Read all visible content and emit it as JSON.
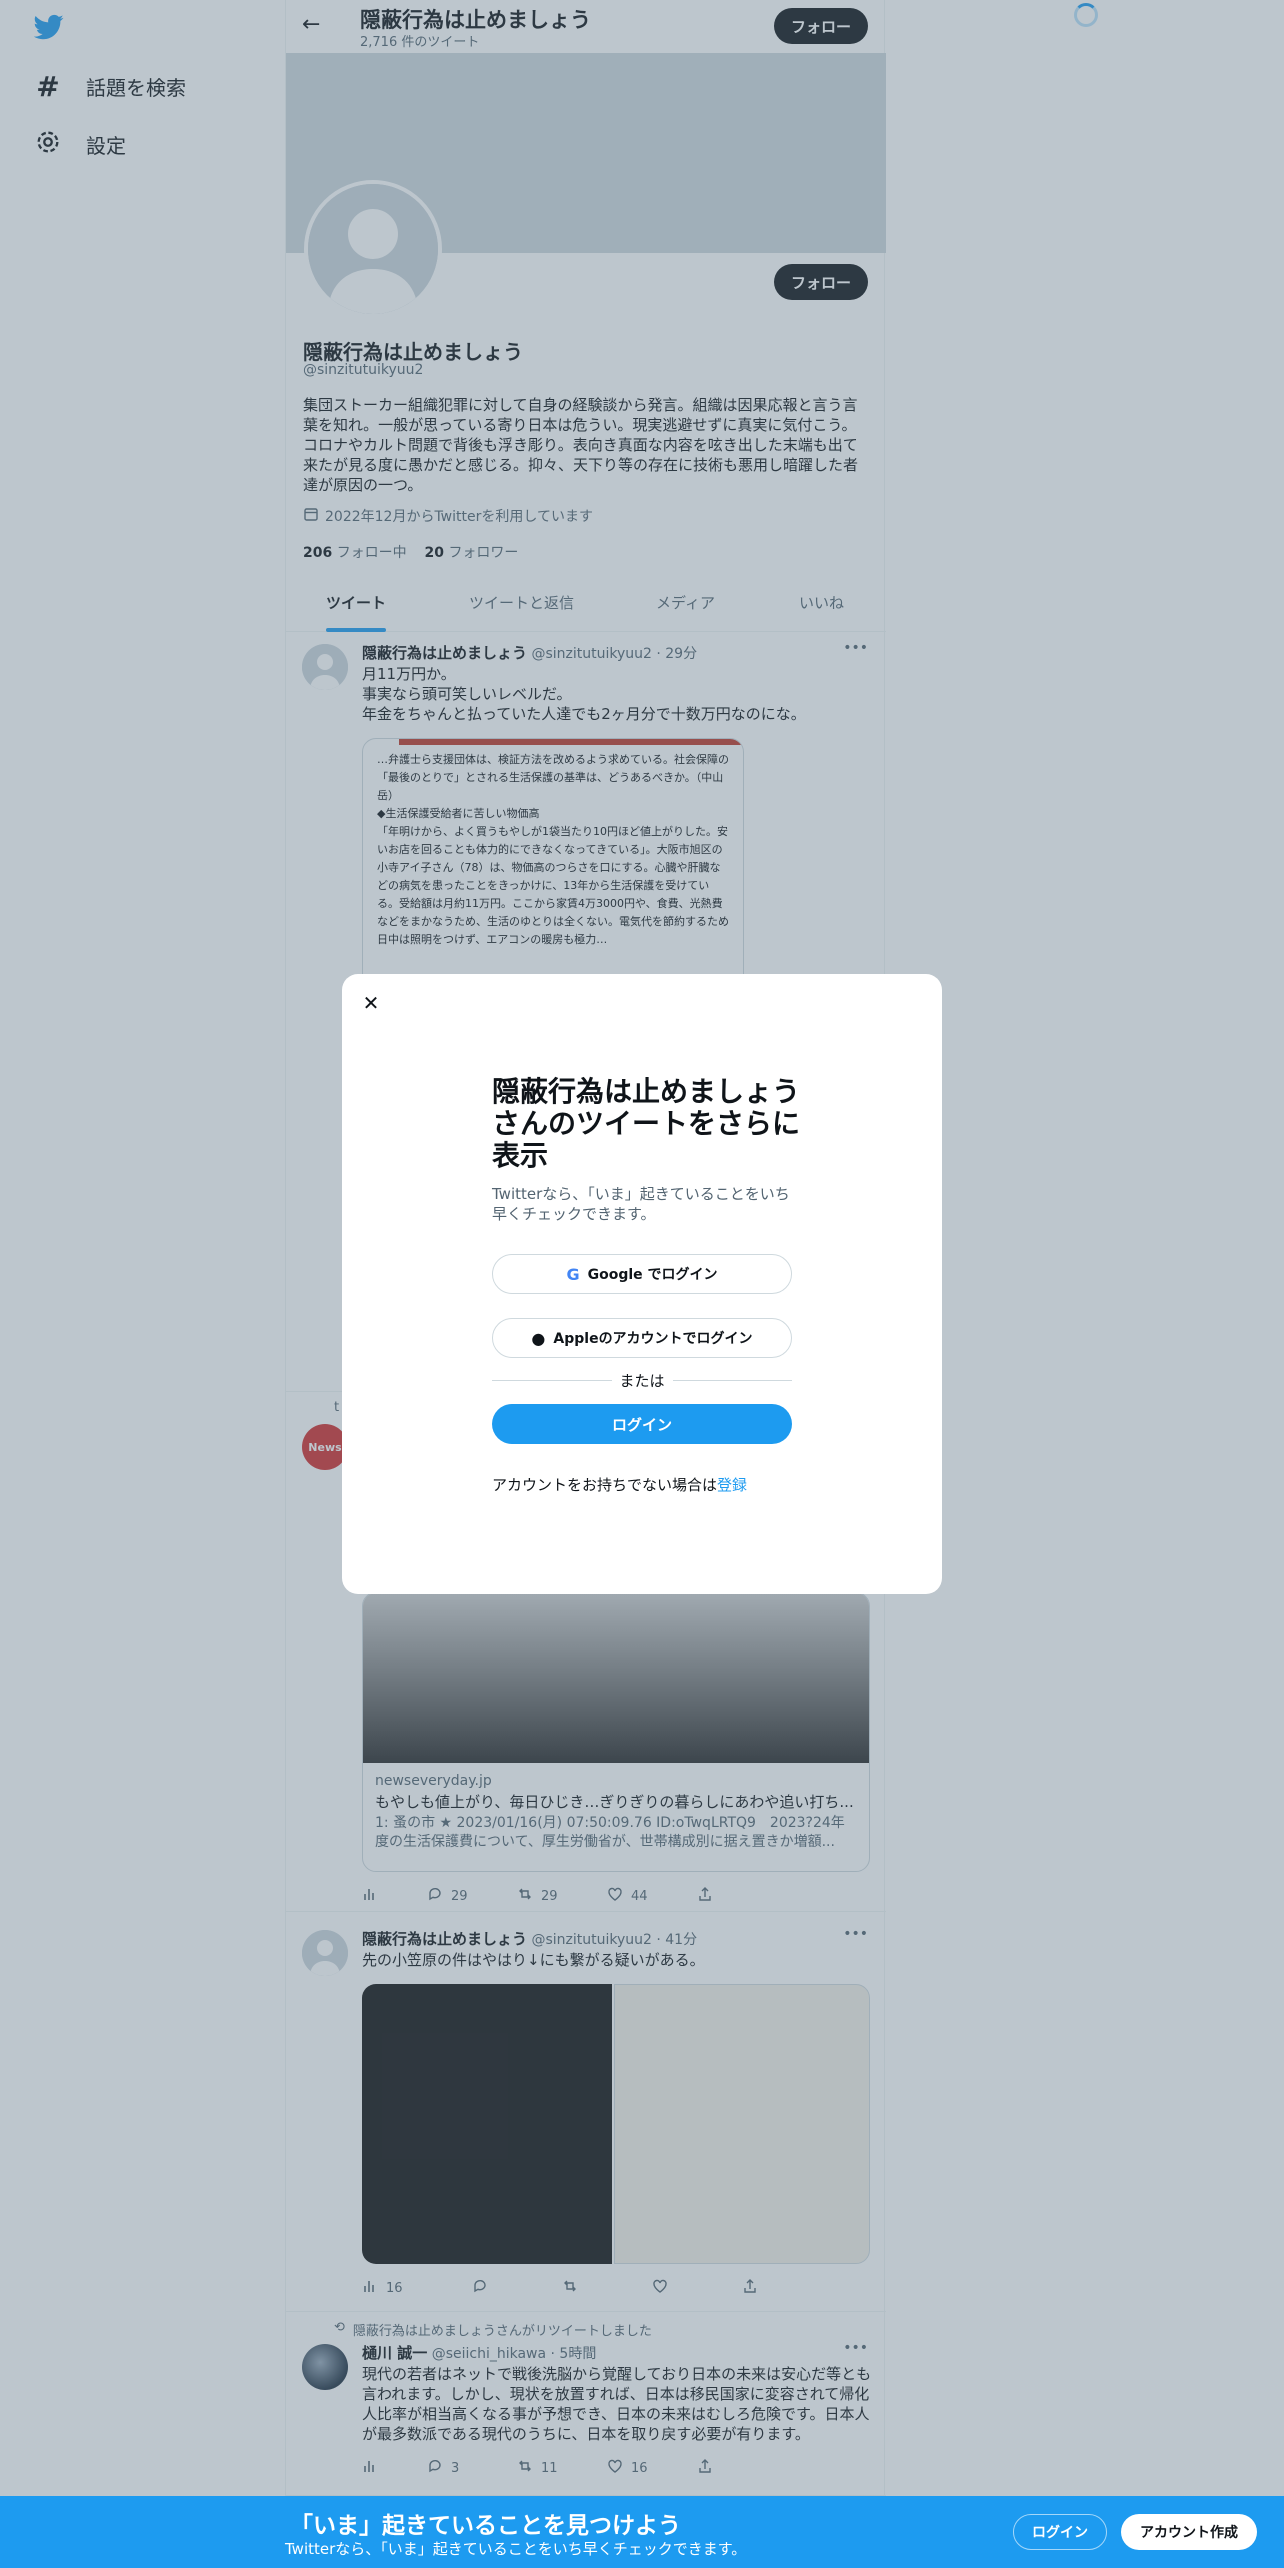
{
  "nav": {
    "explore_label": "話題を検索",
    "settings_label": "設定"
  },
  "header": {
    "name": "隠蔽行為は止めましょう",
    "tweet_count": "2,716 件のツイート",
    "follow_label": "フォロー"
  },
  "profile": {
    "name": "隠蔽行為は止めましょう",
    "handle": "@sinzitutuikyuu2",
    "bio": "集団ストーカー組織犯罪に対して自身の経験談から発言。組織は因果応報と言う言葉を知れ。一般が思っている寄り日本は危うい。現実逃避せずに真実に気付こう。コロナやカルト問題で背後も浮き彫り。表向き真面な内容を呟き出した末端も出て来たが見る度に愚かだと感じる。抑々、天下り等の存在に技術も悪用し暗躍した者達が原因の一つ。",
    "joined": "2022年12月からTwitterを利用しています",
    "following_count": "206",
    "following_label": "フォロー中",
    "followers_count": "20",
    "followers_label": "フォロワー",
    "follow_label": "フォロー"
  },
  "tabs": [
    "ツイート",
    "ツイートと返信",
    "メディア",
    "いいね"
  ],
  "tweets": [
    {
      "name": "隠蔽行為は止めましょう",
      "handle": "@sinzitutuikyuu2 · 29分",
      "body": "月11万円か。\n事実なら頭可笑しいレベルだ。\n年金をちゃんと払っていた人達でも2ヶ月分で十数万円なのにな。",
      "image_text": "…弁護士ら支援団体は、検証方法を改めるよう求めている。社会保障の「最後のとりで」とされる生活保護の基準は、どうあるべきか。（中山岳）\n◆生活保護受給者に苦しい物価高\n「年明けから、よく買うもやしが1袋当たり10円ほど値上がりした。安いお店を回ることも体力的にできなくなってきている」。大阪市旭区の小寺アイ子さん（78）は、物価高のつらさを口にする。心臓や肝臓などの病気を患ったことをきっかけに、13年から生活保護を受けている。受給額は月約11万円。ここから家賃4万3000円や、食費、光熱費などをまかなうため、生活のゆとりは全くない。電気代を節約するため日中は照明をつけず、エアコンの暖房も極力…"
    },
    {
      "retweet_label": "t",
      "card_domain": "newseveryday.jp",
      "card_title": "もやしも値上がり、毎日ひじき…ぎりぎりの暮らしにあわや追い打ち...",
      "card_desc": "1: 蚤の市 ★ 2023/01/16(月) 07:50:09.76 ID:oTwqLRTQ9　2023?24年度の生活保護費について、厚生労働省が、世帯構成別に据え置きか増額...",
      "views": "",
      "replies": "29",
      "retweets": "29",
      "likes": "44"
    },
    {
      "name": "隠蔽行為は止めましょう",
      "handle": "@sinzitutuikyuu2 · 41分",
      "body": "先の小笠原の件はやはり↓にも繋がる疑いがある。",
      "views": "16",
      "replies": "",
      "retweets": "",
      "likes": ""
    },
    {
      "retweet_label": "隠蔽行為は止めましょうさんがリツイートしました",
      "name": "樋川 誠一",
      "handle": "@seiichi_hikawa · 5時間",
      "body": "現代の若者はネットで戦後洗脳から覚醒しており日本の未来は安心だ等とも言われます。しかし、現状を放置すれば、日本は移民国家に変容されて帰化人比率が相当高くなる事が予想でき、日本の未来はむしろ危険です。日本人が最多数派である現代のうちに、日本を取り戻す必要が有ります。",
      "replies": "3",
      "retweets": "11",
      "likes": "16"
    }
  ],
  "modal": {
    "title": "隠蔽行為は止めましょうさんのツイートをさらに表示",
    "subtitle": "Twitterなら、「いま」起きていることをいち早くチェックできます。",
    "google_label": "Google でログイン",
    "apple_label": "Appleのアカウントでログイン",
    "or_label": "または",
    "login_label": "ログイン",
    "signup_prompt": "アカウントをお持ちでない場合は",
    "signup_link": "登録"
  },
  "bottom_bar": {
    "title": "「いま」起きていることを見つけよう",
    "subtitle": "Twitterなら、「いま」起きていることをいち早くチェックできます。",
    "login_label": "ログイン",
    "signup_label": "アカウント作成"
  },
  "colors": {
    "accent": "#1d9bf0",
    "text": "#0f1419",
    "muted": "#536471"
  }
}
